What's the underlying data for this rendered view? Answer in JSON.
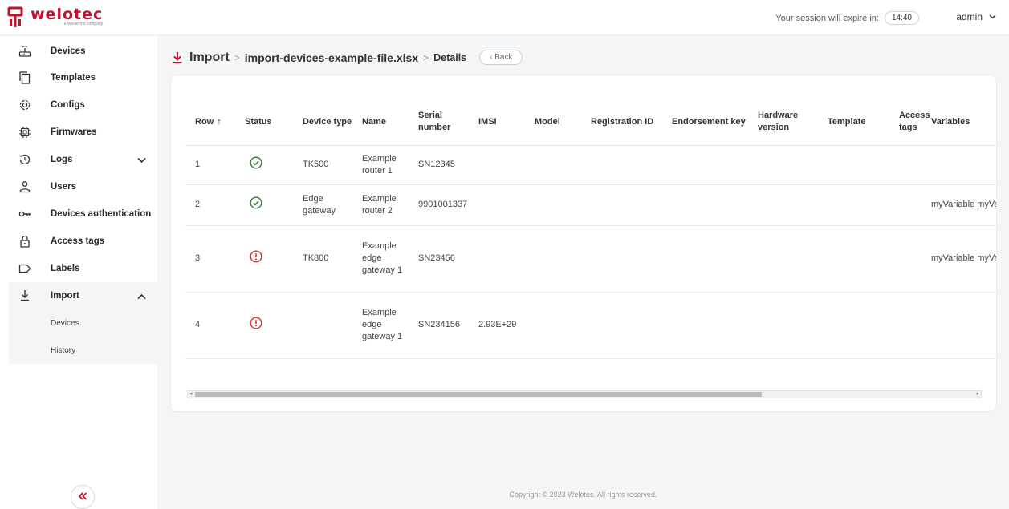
{
  "header": {
    "brand": "welotec",
    "brand_sub": "a Westermo company",
    "session_label": "Your session will expire in:",
    "session_time": "14:40",
    "user": "admin"
  },
  "sidebar": {
    "items": [
      {
        "label": "Devices",
        "icon": "router-icon"
      },
      {
        "label": "Templates",
        "icon": "copy-icon"
      },
      {
        "label": "Configs",
        "icon": "gear-icon"
      },
      {
        "label": "Firmwares",
        "icon": "chip-icon"
      },
      {
        "label": "Logs",
        "icon": "history-icon"
      },
      {
        "label": "Users",
        "icon": "user-icon"
      },
      {
        "label": "Devices authentication",
        "icon": "key-icon"
      },
      {
        "label": "Access tags",
        "icon": "lock-icon"
      },
      {
        "label": "Labels",
        "icon": "label-icon"
      },
      {
        "label": "Import",
        "icon": "import-icon"
      }
    ],
    "sub_items": [
      "Devices",
      "History"
    ]
  },
  "breadcrumb": {
    "root": "Import",
    "sep": ">",
    "file": "import-devices-example-file.xlsx",
    "current": "Details",
    "back": "‹ Back"
  },
  "table": {
    "columns": [
      "Row",
      "Status",
      "Device type",
      "Name",
      "Serial number",
      "IMSI",
      "Model",
      "Registration ID",
      "Endorsement key",
      "Hardware version",
      "Template",
      "Access tags",
      "Variables"
    ],
    "sort_indicator": "↑",
    "rows": [
      {
        "row": "1",
        "status": "ok",
        "device_type": "TK500",
        "name": "Example router 1",
        "serial": "SN12345",
        "imsi": "",
        "model": "",
        "reg_id": "",
        "endorsement": "",
        "hw": "",
        "template": "",
        "tags": "",
        "variables": ""
      },
      {
        "row": "2",
        "status": "ok",
        "device_type": "Edge gateway",
        "name": "Example router 2",
        "serial": "9901001337",
        "imsi": "",
        "model": "",
        "reg_id": "",
        "endorsement": "",
        "hw": "",
        "template": "",
        "tags": "",
        "variables": "myVariable myVariable"
      },
      {
        "row": "3",
        "status": "error",
        "device_type": "TK800",
        "name": "Example edge gateway 1",
        "serial": "SN23456",
        "imsi": "",
        "model": "",
        "reg_id": "",
        "endorsement": "",
        "hw": "",
        "template": "",
        "tags": "",
        "variables": "myVariable myVariable"
      },
      {
        "row": "4",
        "status": "error",
        "device_type": "",
        "name": "Example edge gateway 1",
        "serial": "SN234156",
        "imsi": "2.93E+29",
        "model": "",
        "reg_id": "",
        "endorsement": "",
        "hw": "",
        "template": "",
        "tags": "",
        "variables": ""
      }
    ]
  },
  "colors": {
    "ok": "#2e7d32",
    "error": "#d32f2f",
    "brand": "#c8102e"
  },
  "footer": "Copyright © 2023 Welotec. All rights reserved."
}
